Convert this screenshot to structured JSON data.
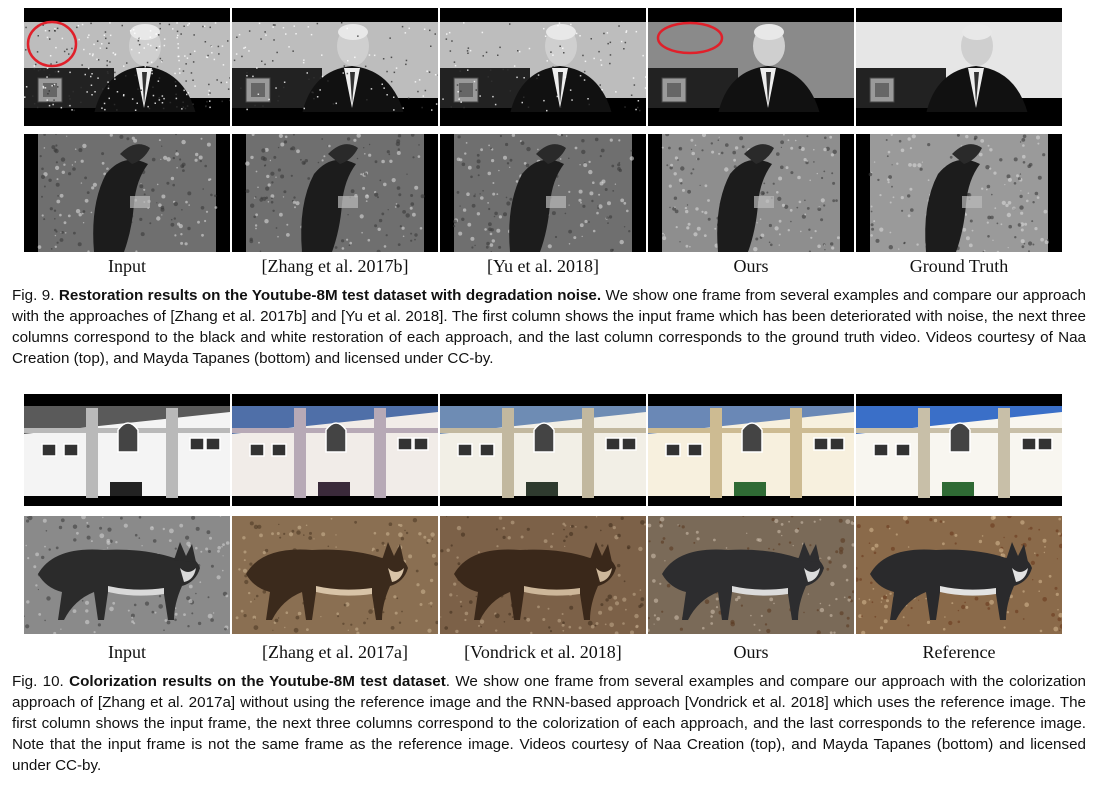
{
  "fig9": {
    "labels": [
      "Input",
      "[Zhang et al. 2017b]",
      "[Yu et al. 2018]",
      "Ours",
      "Ground Truth"
    ],
    "caption": {
      "prefix": "Fig. 9.",
      "title": "Restoration results on the Youtube-8M test dataset with degradation noise.",
      "body": " We show one frame from several examples and compare our approach with the approaches of [Zhang et al. 2017b] and [Yu et al. 2018]. The first column shows the input frame which has been deteriorated with noise, the next three columns correspond to the black and white restoration of each approach, and the last column corresponds to the ground truth video. Videos courtesy of Naa Creation (top), and Mayda Tapanes (bottom) and licensed under CC-by."
    }
  },
  "fig10": {
    "labels": [
      "Input",
      "[Zhang et al. 2017a]",
      "[Vondrick et al. 2018]",
      "Ours",
      "Reference"
    ],
    "caption": {
      "prefix": "Fig. 10.",
      "title": "Colorization results on the Youtube-8M test dataset",
      "body": ". We show one frame from several examples and compare our approach with the colorization approach of [Zhang et al. 2017a] without using the reference image and the RNN-based approach [Vondrick et al. 2018] which uses the reference image. The first column shows the input frame, the next three columns correspond to the colorization of each approach, and the last corresponds to the reference image. Note that the input frame is not the same frame as the reference image. Videos courtesy of Naa Creation (top), and Mayda Tapanes (bottom) and licensed under CC-by."
    }
  },
  "colors": {
    "annotation_circle": "#e0202a",
    "sky_blue": "#3a6fc8",
    "building_green": "#2f6a34"
  }
}
